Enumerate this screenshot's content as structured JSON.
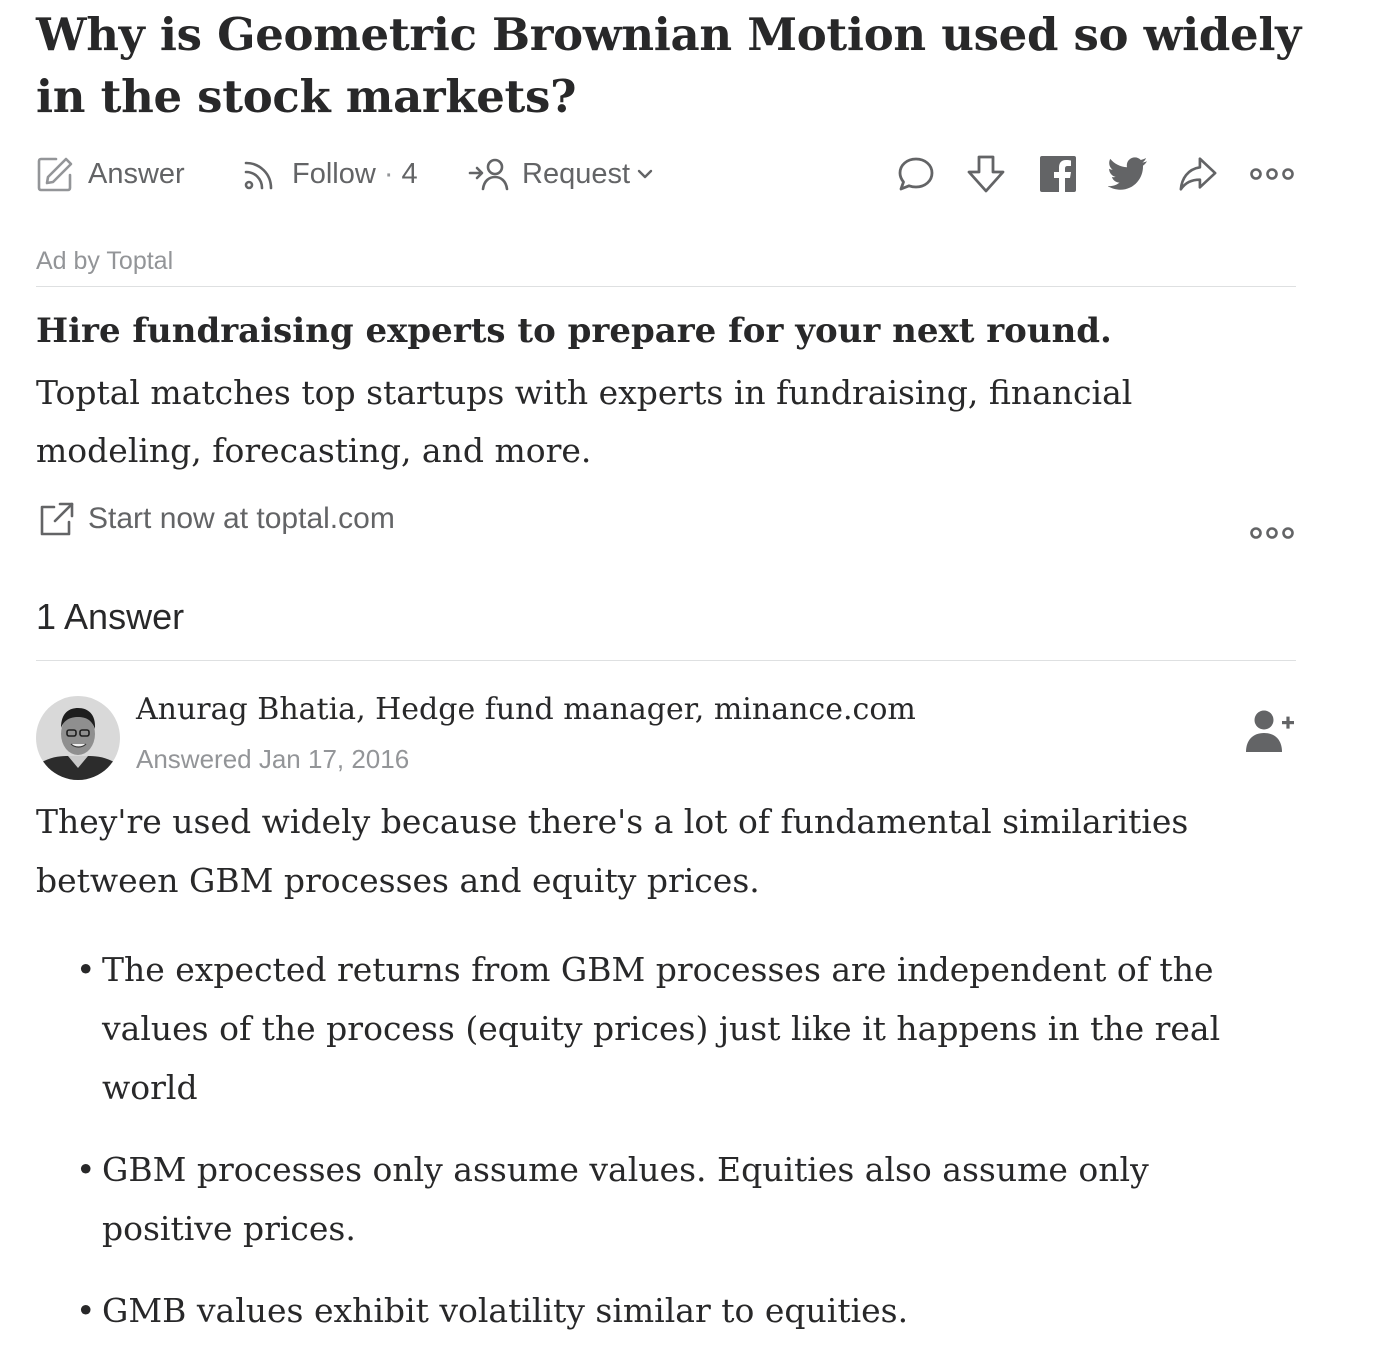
{
  "question": {
    "title": "Why is Geometric Brownian Motion used so widely in the stock markets?"
  },
  "actions": {
    "answer_label": "Answer",
    "follow_label": "Follow",
    "follow_separator": "·",
    "follow_count": "4",
    "request_label": "Request",
    "icons": [
      "comment-icon",
      "downvote-icon",
      "facebook-icon",
      "twitter-icon",
      "share-icon",
      "more-icon"
    ]
  },
  "ad": {
    "label": "Ad by Toptal",
    "headline": "Hire fundraising experts to prepare for your next round.",
    "body": "Toptal matches top startups with experts in fundraising, financial modeling, forecasting, and more.",
    "link_label": "Start now at toptal.com"
  },
  "answers": {
    "count_label": "1 Answer",
    "items": [
      {
        "author": "Anurag Bhatia, Hedge fund manager, minance.com",
        "date": "Answered Jan 17, 2016",
        "intro": "They're used widely because there's a lot of fundamental similarities between GBM processes and equity prices.",
        "bullets": [
          "The expected returns from GBM processes are independent of the values of the process (equity prices) just like it happens in the real world",
          "GBM processes only assume values. Equities also assume only positive prices.",
          "GMB values exhibit volatility similar to equities."
        ]
      }
    ]
  },
  "colors": {
    "text_primary": "#282829",
    "text_secondary": "#636466",
    "text_muted": "#939598",
    "divider": "#dee0e1"
  }
}
